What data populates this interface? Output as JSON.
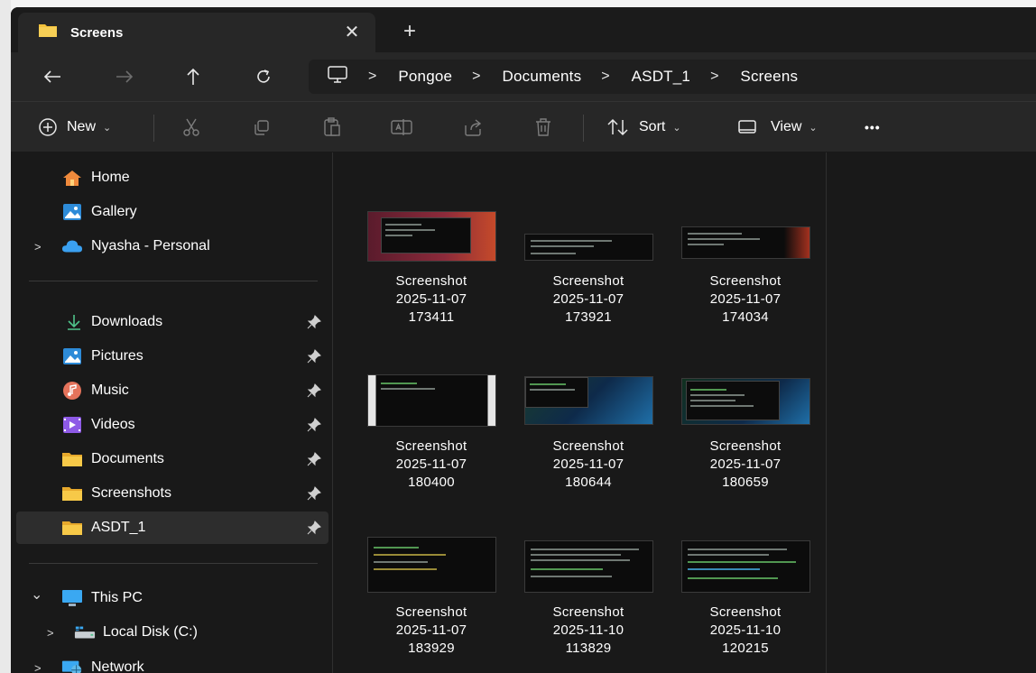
{
  "window": {
    "tab_title": "Screens",
    "tab_close": "✕",
    "new_tab": "+"
  },
  "nav": {
    "back": "←",
    "forward": "→",
    "up": "↑",
    "refresh": "↻"
  },
  "address": {
    "sep": ">",
    "crumbs": [
      "Pongoe",
      "Documents",
      "ASDT_1",
      "Screens"
    ]
  },
  "toolbar": {
    "new_label": "New",
    "sort_label": "Sort",
    "view_label": "View",
    "more": "•••",
    "chevron": "⌄"
  },
  "sidebar": {
    "quick": [
      {
        "label": "Home",
        "icon": "home-icon"
      },
      {
        "label": "Gallery",
        "icon": "gallery-icon"
      },
      {
        "label": "Nyasha - Personal",
        "icon": "onedrive-cloud-icon"
      }
    ],
    "pinned": [
      {
        "label": "Downloads",
        "icon": "download-icon"
      },
      {
        "label": "Pictures",
        "icon": "pictures-icon"
      },
      {
        "label": "Music",
        "icon": "music-icon"
      },
      {
        "label": "Videos",
        "icon": "videos-icon"
      },
      {
        "label": "Documents",
        "icon": "folder-icon"
      },
      {
        "label": "Screenshots",
        "icon": "folder-icon"
      },
      {
        "label": "ASDT_1",
        "icon": "folder-icon"
      }
    ],
    "tree": [
      {
        "label": "This PC",
        "icon": "monitor-icon"
      },
      {
        "label": "Local Disk (C:)",
        "icon": "drive-icon"
      },
      {
        "label": "Network",
        "icon": "network-icon"
      }
    ],
    "expander": ">",
    "expanded": "⌄"
  },
  "files": [
    {
      "line1": "Screenshot",
      "line2": "2025-11-07",
      "line3": "173411"
    },
    {
      "line1": "Screenshot",
      "line2": "2025-11-07",
      "line3": "173921"
    },
    {
      "line1": "Screenshot",
      "line2": "2025-11-07",
      "line3": "174034"
    },
    {
      "line1": "Screenshot",
      "line2": "2025-11-07",
      "line3": "180400"
    },
    {
      "line1": "Screenshot",
      "line2": "2025-11-07",
      "line3": "180644"
    },
    {
      "line1": "Screenshot",
      "line2": "2025-11-07",
      "line3": "180659"
    },
    {
      "line1": "Screenshot",
      "line2": "2025-11-07",
      "line3": "183929"
    },
    {
      "line1": "Screenshot",
      "line2": "2025-11-10",
      "line3": "113829"
    },
    {
      "line1": "Screenshot",
      "line2": "2025-11-10",
      "line3": "120215"
    }
  ],
  "colors": {
    "folder": "#f3c13a",
    "accent": "#4cc2ff",
    "background": "#191919",
    "panel": "#272727"
  }
}
